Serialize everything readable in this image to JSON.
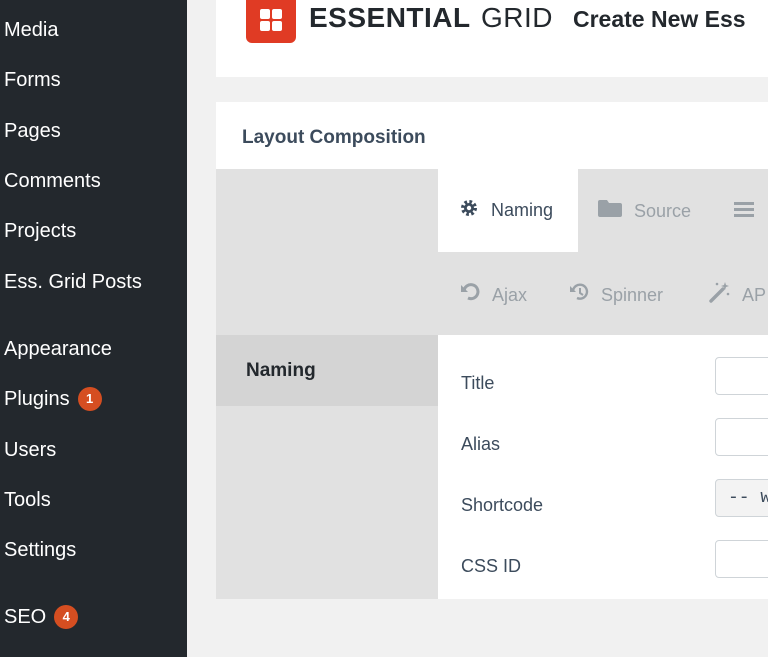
{
  "sidebar": {
    "items": [
      {
        "label": "Media"
      },
      {
        "label": "Forms"
      },
      {
        "label": "Pages"
      },
      {
        "label": "Comments"
      },
      {
        "label": "Projects"
      },
      {
        "label": "Ess. Grid Posts"
      },
      {
        "label": "Appearance"
      },
      {
        "label": "Plugins",
        "badge": "1"
      },
      {
        "label": "Users"
      },
      {
        "label": "Tools"
      },
      {
        "label": "Settings"
      },
      {
        "label": "SEO",
        "badge": "4"
      }
    ]
  },
  "header": {
    "brand_bold": "ESSENTIAL",
    "brand_light": "GRID",
    "title": "Create New Ess",
    "logo_color": "#e03b24"
  },
  "panel": {
    "title": "Layout Composition",
    "tabs": [
      {
        "label": "Naming",
        "icon": "gear-icon",
        "active": true
      },
      {
        "label": "Source",
        "icon": "folder-icon"
      },
      {
        "label": "",
        "icon": "menu-icon"
      },
      {
        "label": "Ajax",
        "icon": "undo-icon"
      },
      {
        "label": "Spinner",
        "icon": "history-icon"
      },
      {
        "label": "AP",
        "icon": "magic-wand-icon"
      }
    ],
    "section": "Naming",
    "fields": [
      {
        "label": "Title",
        "value": ""
      },
      {
        "label": "Alias",
        "value": ""
      },
      {
        "label": "Shortcode",
        "value": "-- wr"
      },
      {
        "label": "CSS ID",
        "value": ""
      }
    ]
  },
  "colors": {
    "sidebar_bg": "#23282d",
    "badge": "#d54e21",
    "accent": "#e03b24"
  }
}
